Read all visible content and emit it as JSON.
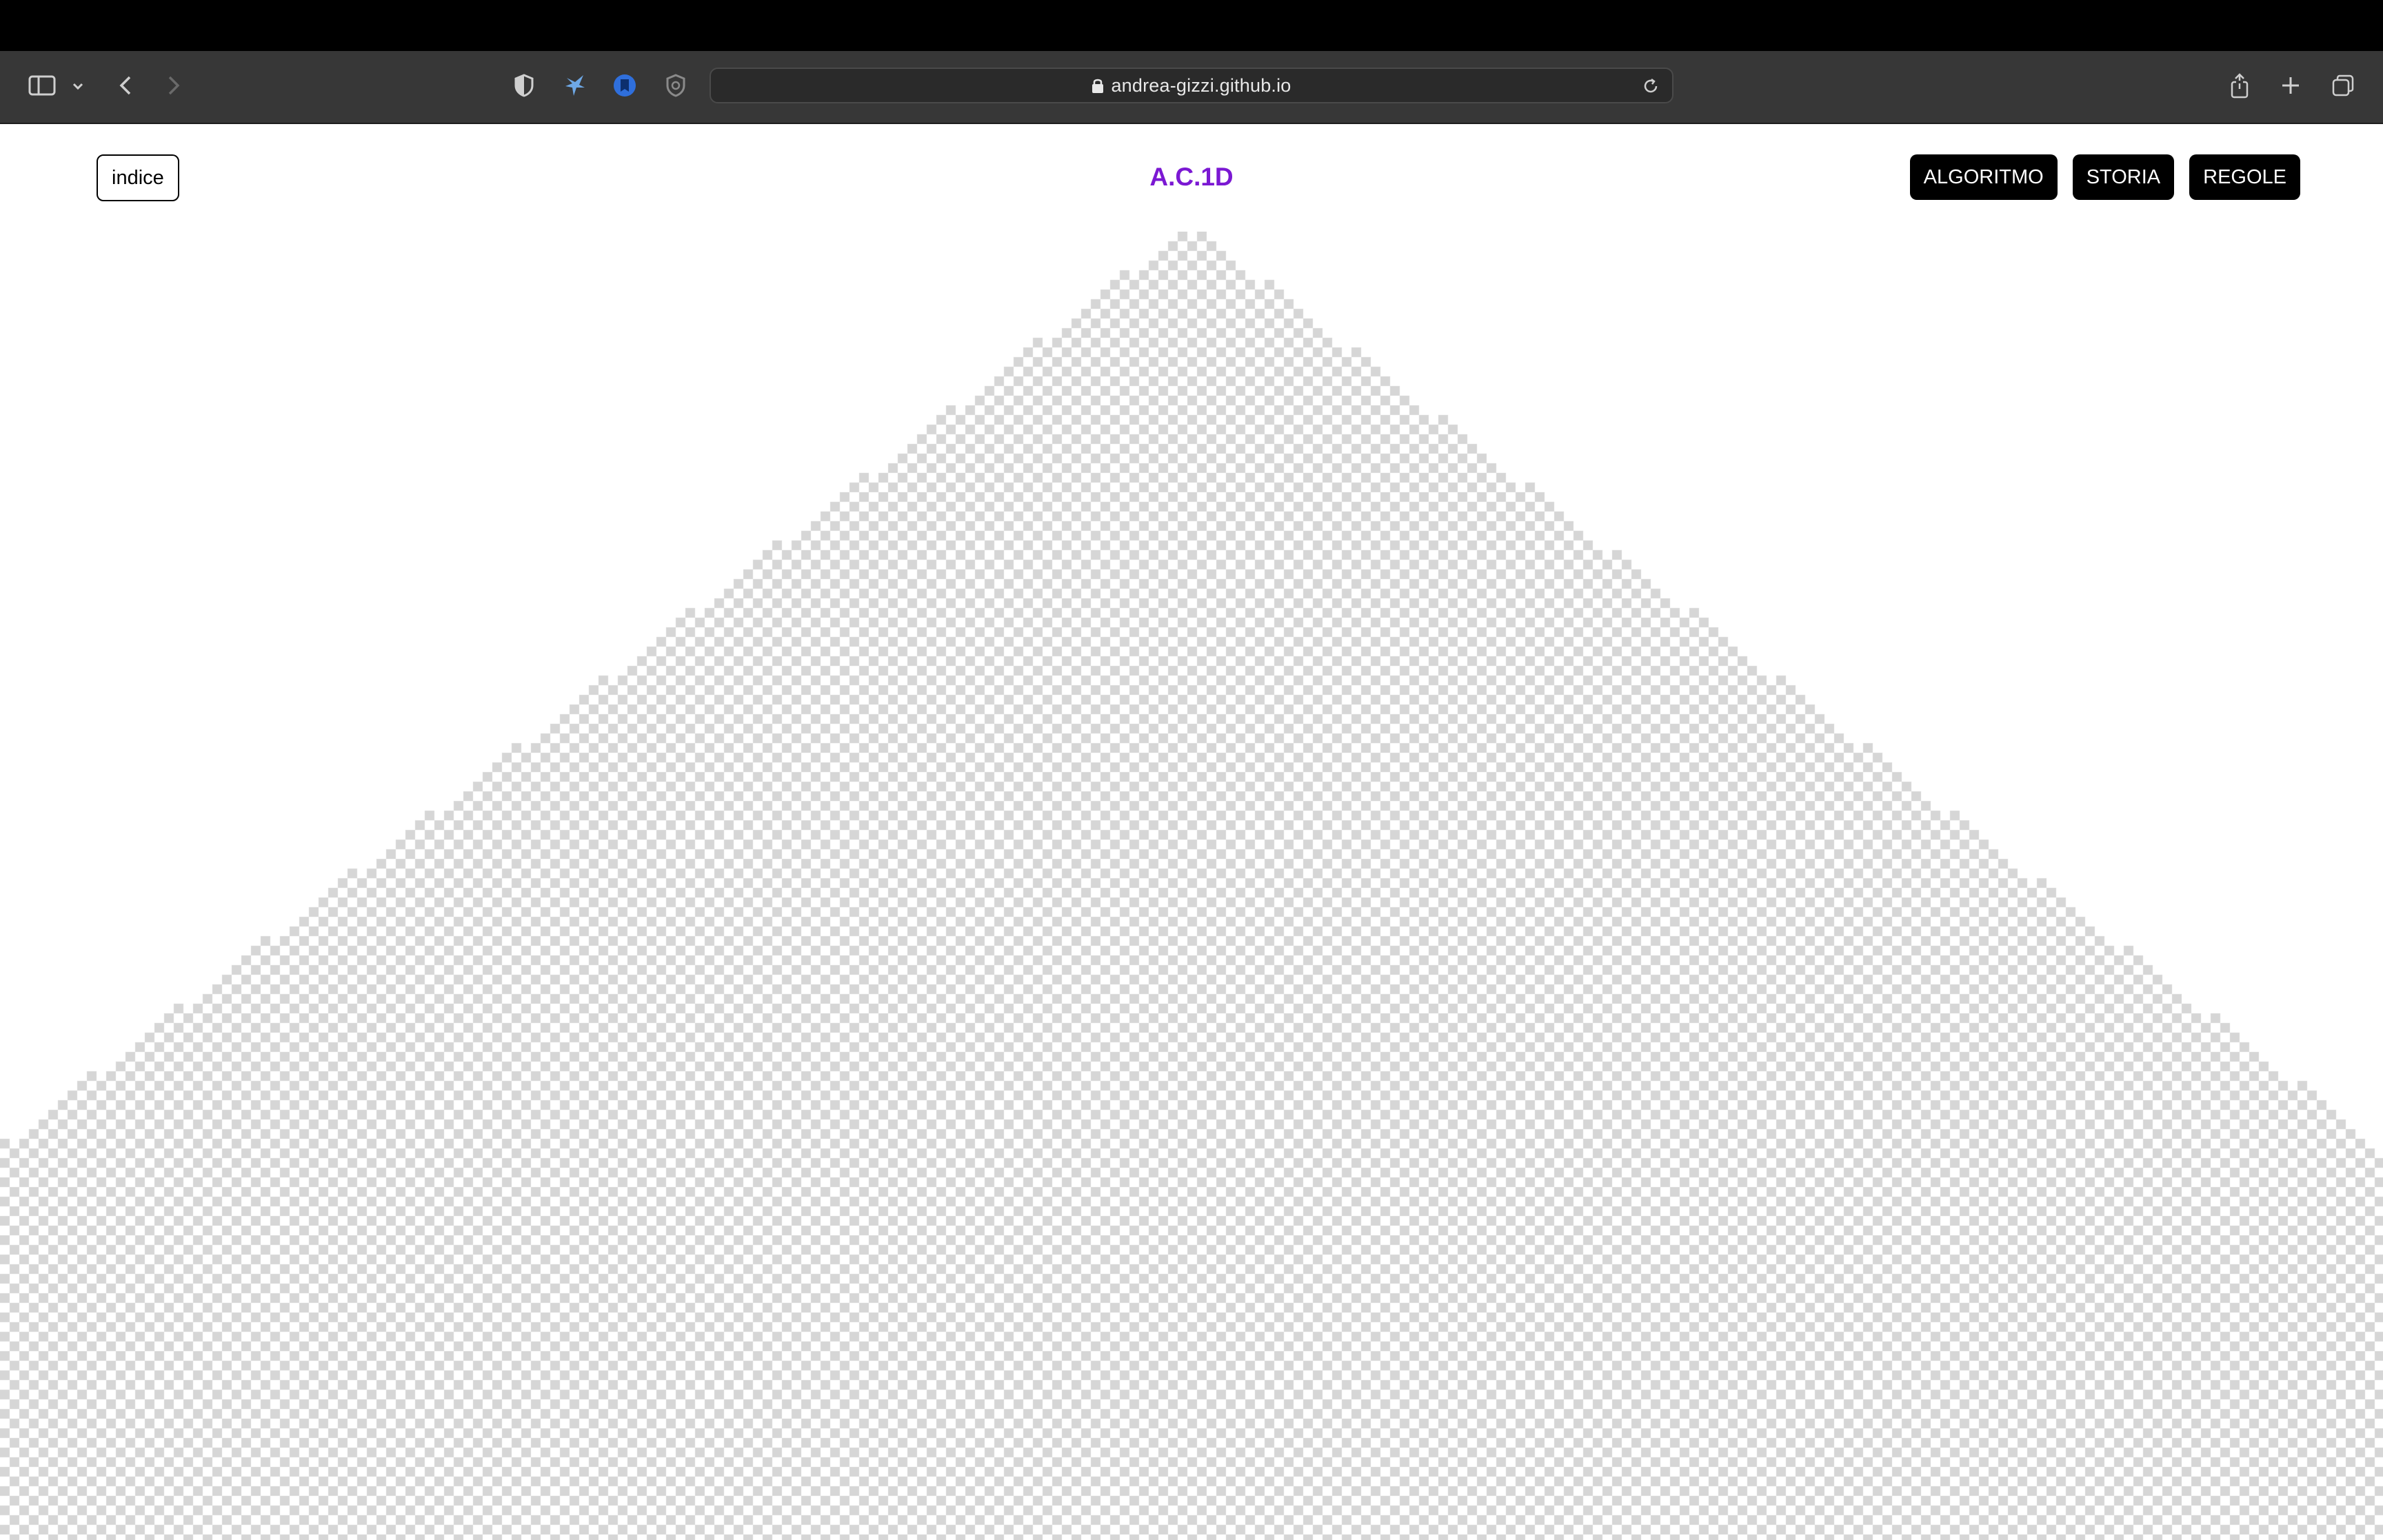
{
  "browser": {
    "url": "andrea-gizzi.github.io",
    "icons": [
      "sidebar-icon",
      "chevron-down-icon",
      "back-icon",
      "forward-icon",
      "privacy-shield-icon",
      "extension-bird-icon",
      "extension-blue-icon",
      "extension-badge-icon",
      "lock-icon",
      "reload-icon",
      "share-icon",
      "new-tab-icon",
      "tab-overview-icon"
    ]
  },
  "page": {
    "index_button": "indice",
    "title": "A.C.1D",
    "nav": [
      "ALGORITMO",
      "STORIA",
      "REGOLE"
    ]
  },
  "colors": {
    "title": "#7b18d3",
    "cell": "#d6d6d6",
    "nav_bg": "#000000"
  },
  "automaton": {
    "type": "elementary cellular automaton, checkerboard triangle pattern"
  }
}
